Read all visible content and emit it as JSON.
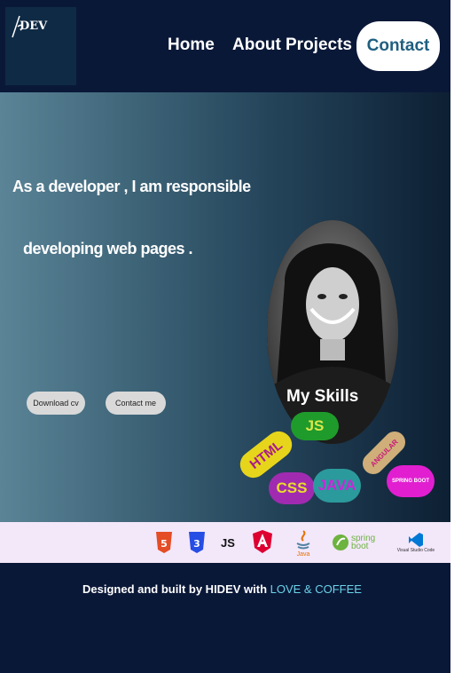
{
  "logo": {
    "text": "DEV"
  },
  "nav": {
    "home": "Home",
    "about": "About",
    "projects": "Projects",
    "contact": "Contact"
  },
  "hero": {
    "line1": "As a developer , I am responsible",
    "line2": "developing web pages .",
    "download_label": "Download cv",
    "contact_label": "Contact me"
  },
  "skills": {
    "title": "My Skills",
    "pills": [
      "HTML",
      "JS",
      "CSS",
      "JAVA",
      "ANGULAR",
      "SPRING BOOT"
    ]
  },
  "tech_strip": {
    "items": [
      "HTML",
      "CSS",
      "JS",
      "Angular",
      "Java",
      "spring boot",
      "Visual Studio Code"
    ]
  },
  "footer": {
    "prefix": "Designed and built by HIDEV with ",
    "highlight": "LOVE & COFFEE"
  }
}
